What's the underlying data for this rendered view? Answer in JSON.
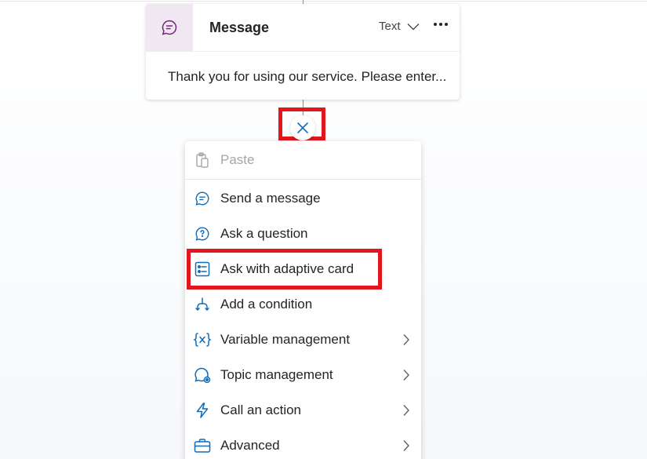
{
  "node": {
    "title": "Message",
    "type_label": "Text",
    "body": "Thank you for using our service. Please enter..."
  },
  "menu": {
    "items": [
      {
        "label": "Paste",
        "icon": "paste-icon",
        "disabled": true
      },
      {
        "label": "Send a message",
        "icon": "message-icon"
      },
      {
        "label": "Ask a question",
        "icon": "question-icon"
      },
      {
        "label": "Ask with adaptive card",
        "icon": "adaptive-card-icon",
        "highlighted": true
      },
      {
        "label": "Add a condition",
        "icon": "condition-icon"
      },
      {
        "label": "Variable management",
        "icon": "variable-icon",
        "submenu": true
      },
      {
        "label": "Topic management",
        "icon": "topic-icon",
        "submenu": true
      },
      {
        "label": "Call an action",
        "icon": "action-icon",
        "submenu": true
      },
      {
        "label": "Advanced",
        "icon": "briefcase-icon",
        "submenu": true
      }
    ]
  },
  "colors": {
    "accent": "#0f6cbd",
    "node_icon_bg": "#f1e7f2",
    "node_icon": "#742774",
    "highlight": "#e3161b"
  }
}
